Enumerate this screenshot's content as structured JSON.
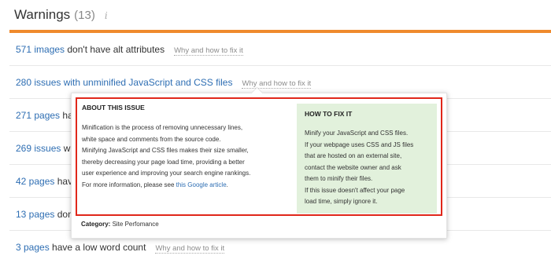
{
  "header": {
    "title": "Warnings",
    "count": "(13)",
    "info_glyph": "i"
  },
  "colors": {
    "accent_bar": "#ef8a2d",
    "link": "#2e6eb3",
    "highlight_border": "#e0271a",
    "how_to_fix_bg": "#e2f1dc"
  },
  "rows": [
    {
      "link_text": "571 images",
      "text": " don't have alt attributes",
      "fix": "Why and how to fix it"
    },
    {
      "link_text": "280 issues",
      "text": " with unminified JavaScript and CSS files",
      "fix": "Why and how to fix it"
    },
    {
      "link_text": "271 pages",
      "text": " hav"
    },
    {
      "link_text": "269 issues",
      "text": " wi"
    },
    {
      "link_text": "42 pages",
      "text": " have"
    },
    {
      "link_text": "13 pages",
      "text": " don"
    },
    {
      "link_text": "3 pages",
      "text": " have a low word count",
      "fix": "Why and how to fix it"
    }
  ],
  "popup": {
    "about_title": "ABOUT THIS ISSUE",
    "about_lines": [
      "Minification is the process of removing unnecessary lines,",
      "white space and comments from the source code.",
      "Minifying JavaScript and CSS files makes their size smaller,",
      "thereby decreasing your page load time, providing a better",
      "user experience and improving your search engine rankings."
    ],
    "about_more": "For more information, please see ",
    "about_link": "this Google article",
    "about_link_end": ".",
    "how_title": "HOW TO FIX IT",
    "how_lines": [
      "Minify your JavaScript and CSS files.",
      "If your webpage uses CSS and JS files",
      "that are hosted on an external site,",
      "contact the website owner and ask",
      "them to minify their files.",
      "If this issue doesn't affect your page",
      "load time, simply ignore it."
    ],
    "category_label": "Category:",
    "category_value": " Site Perfomance"
  }
}
